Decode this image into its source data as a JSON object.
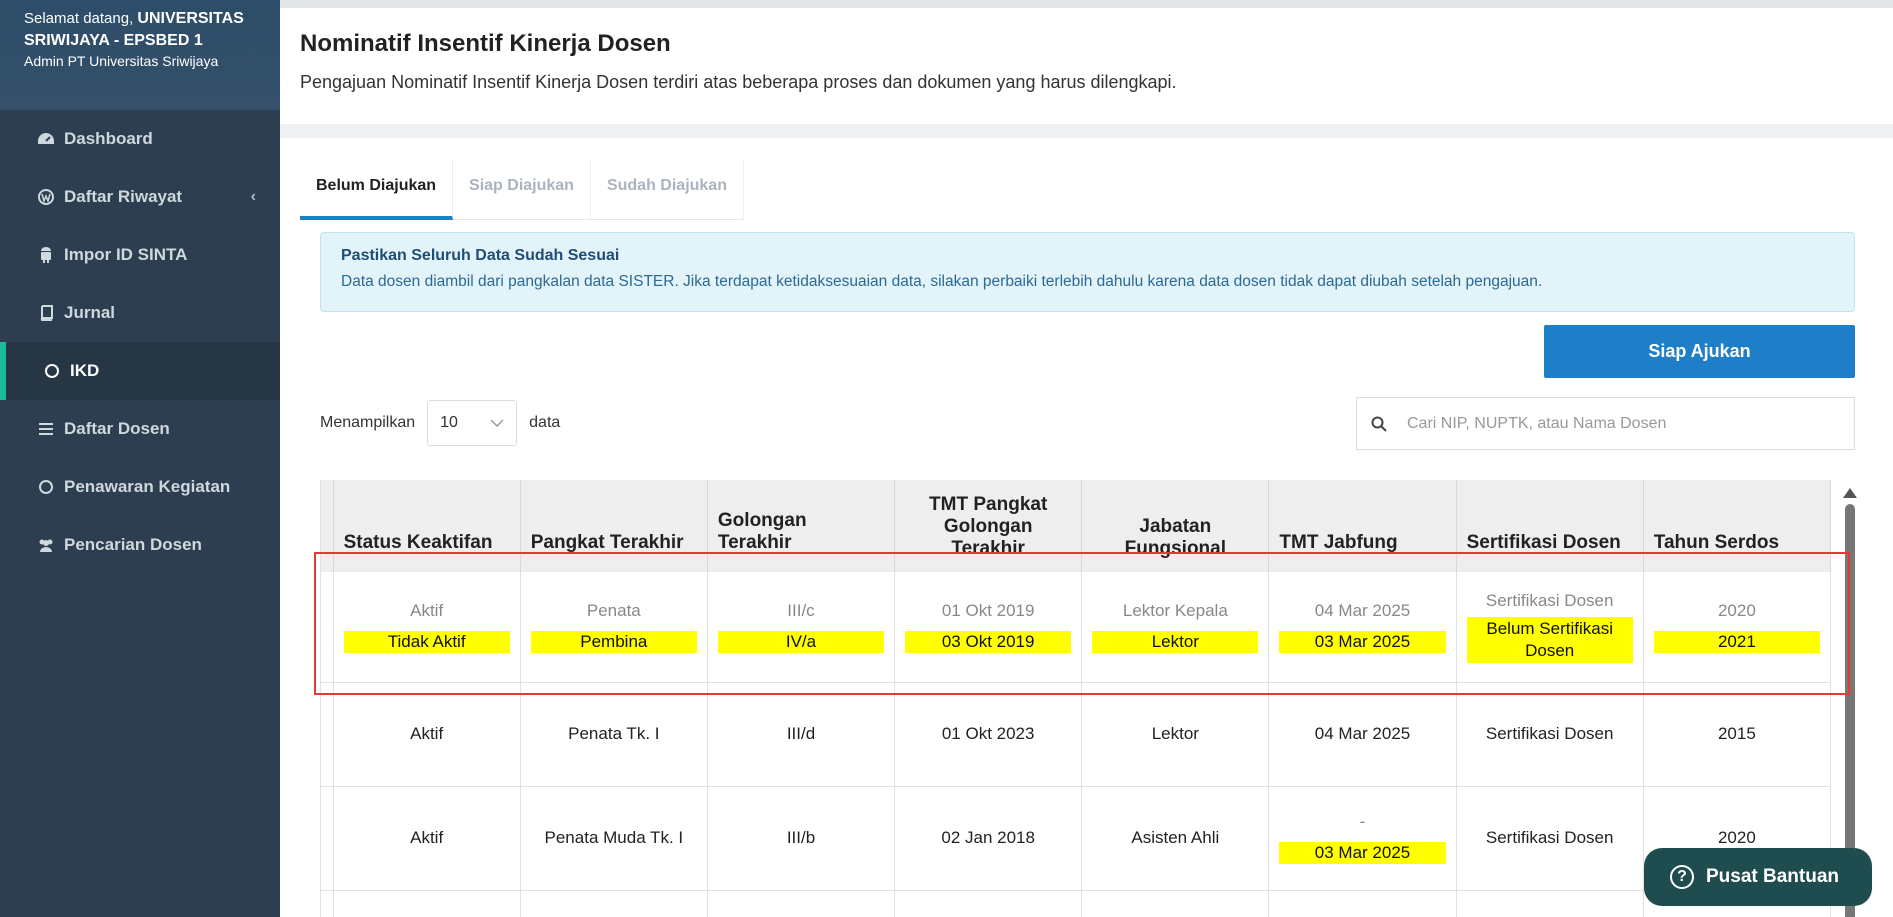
{
  "sidebar": {
    "welcome_prefix": "Selamat datang,",
    "institution_line1": "UNIVERSITAS",
    "institution_line2": "SRIWIJAYA - EPSBED 1",
    "role": "Admin PT Universitas Sriwijaya",
    "items": [
      {
        "label": "Dashboard",
        "icon": "dashboard-icon"
      },
      {
        "label": "Daftar Riwayat",
        "icon": "wordpress-icon"
      },
      {
        "label": "Impor ID SINTA",
        "icon": "android-icon"
      },
      {
        "label": "Jurnal",
        "icon": "book-icon"
      },
      {
        "label": "IKD",
        "icon": "circle-icon"
      },
      {
        "label": "Daftar Dosen",
        "icon": "list-icon"
      },
      {
        "label": "Penawaran Kegiatan",
        "icon": "circle-icon"
      },
      {
        "label": "Pencarian Dosen",
        "icon": "users-icon"
      }
    ]
  },
  "header": {
    "title": "Nominatif Insentif Kinerja Dosen",
    "subtitle": "Pengajuan Nominatif Insentif Kinerja Dosen terdiri atas beberapa proses dan dokumen yang harus dilengkapi."
  },
  "tabs": [
    "Belum Diajukan",
    "Siap Diajukan",
    "Sudah Diajukan"
  ],
  "alert": {
    "title": "Pastikan Seluruh Data Sudah Sesuai",
    "body": "Data dosen diambil dari pangkalan data SISTER. Jika terdapat ketidaksesuaian data, silakan perbaiki terlebih dahulu karena data dosen tidak dapat diubah setelah pengajuan."
  },
  "actions": {
    "siap_ajukan": "Siap Ajukan"
  },
  "length": {
    "prefix": "Menampilkan",
    "value": "10",
    "suffix": "data"
  },
  "search": {
    "placeholder": "Cari NIP, NUPTK, atau Nama Dosen"
  },
  "table": {
    "headers": [
      "Status Keaktifan",
      "Pangkat Terakhir",
      "Golongan Terakhir",
      "TMT Pangkat Golongan Terakhir",
      "Jabatan Fungsional",
      "TMT Jabfung",
      "Sertifikasi Dosen",
      "Tahun Serdos"
    ],
    "row1_old": [
      "Aktif",
      "Penata",
      "III/c",
      "01 Okt 2019",
      "Lektor Kepala",
      "04 Mar 2025",
      "Sertifikasi Dosen",
      "2020"
    ],
    "row1_new": [
      "Tidak Aktif",
      "Pembina",
      "IV/a",
      "03 Okt 2019",
      "Lektor",
      "03 Mar 2025",
      "Belum Sertifikasi Dosen",
      "2021"
    ],
    "row2": [
      "Aktif",
      "Penata Tk. I",
      "III/d",
      "01 Okt 2023",
      "Lektor",
      "04 Mar 2025",
      "Sertifikasi Dosen",
      "2015"
    ],
    "row3": [
      "Aktif",
      "Penata Muda Tk. I",
      "III/b",
      "02 Jan 2018",
      "Asisten Ahli",
      "-",
      "Sertifikasi Dosen",
      "2020"
    ],
    "row3_new_tmt": "03 Mar 2025"
  },
  "help": {
    "label": "Pusat Bantuan"
  },
  "colors": {
    "accent": "#1e7ec8",
    "sidebar": "#2c3e50",
    "highlight": "#ffff00",
    "selection_border": "#e53935"
  }
}
